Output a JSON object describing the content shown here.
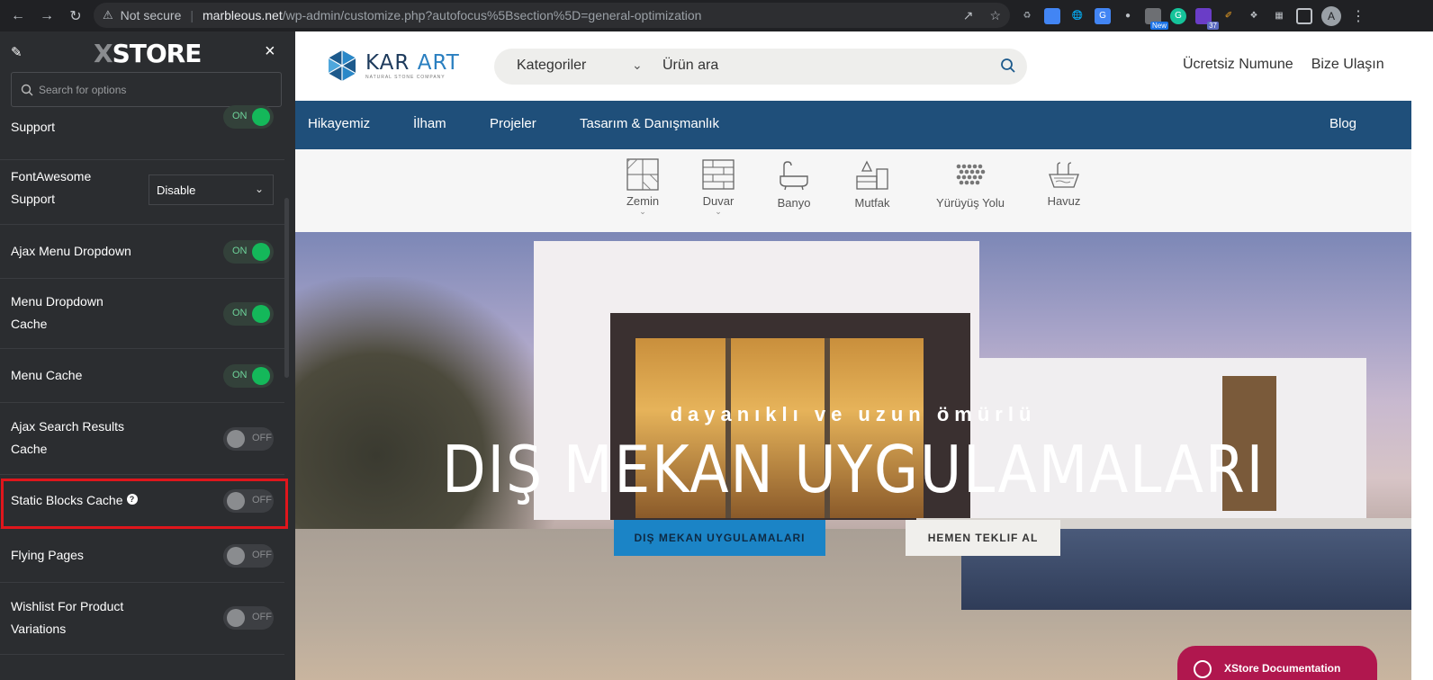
{
  "browser": {
    "security_label": "Not secure",
    "url_domain": "marbleous.net",
    "url_path": "/wp-admin/customize.php?autofocus%5Bsection%5D=general-optimization",
    "profile_initial": "A",
    "ext_badge_new": "New",
    "ext_badge_count": "37"
  },
  "sidebar": {
    "logo_x": "X",
    "logo_text": "STORE",
    "close_glyph": "×",
    "search_placeholder": "Search for options",
    "options": [
      {
        "label": "Support",
        "state": "ON"
      },
      {
        "label": "FontAwesome Support",
        "value": "Disable"
      },
      {
        "label": "Ajax Menu Dropdown",
        "state": "ON"
      },
      {
        "label": "Menu Dropdown Cache",
        "state": "ON"
      },
      {
        "label": "Menu Cache",
        "state": "ON"
      },
      {
        "label": "Ajax Search Results Cache",
        "state": "OFF"
      },
      {
        "label": "Static Blocks Cache",
        "state": "OFF",
        "help": "?"
      },
      {
        "label": "Flying Pages",
        "state": "OFF"
      },
      {
        "label": "Wishlist For Product Variations",
        "state": "OFF"
      }
    ]
  },
  "site": {
    "brand_a": "KAR",
    "brand_b": "ART",
    "brand_sub": "NATURAL STONE COMPANY",
    "category_select": "Kategoriler",
    "search_placeholder": "Ürün ara",
    "header_links": [
      "Ücretsiz Numune",
      "Bize Ulaşın"
    ],
    "nav": [
      "Hikayemiz",
      "İlham",
      "Projeler",
      "Tasarım & Danışmanlık",
      "Blog"
    ],
    "categories": [
      "Zemin",
      "Duvar",
      "Banyo",
      "Mutfak",
      "Yürüyüş Yolu",
      "Havuz"
    ],
    "hero_kicker": "dayanıklı ve uzun ömürlü",
    "hero_title": "DIŞ MEKAN UYGULAMALARI",
    "hero_btn_primary": "DIŞ MEKAN UYGULAMALARI",
    "hero_btn_secondary": "HEMEN TEKLIF AL",
    "doc_button": "XStore Documentation"
  },
  "colors": {
    "sidebar_bg": "#2b2d30",
    "toggle_on": "#14b85a",
    "nav_bg": "#1f4f7a",
    "highlight": "#e0161c",
    "primary_btn": "#1b84c6",
    "doc_pill": "#b0174e"
  }
}
